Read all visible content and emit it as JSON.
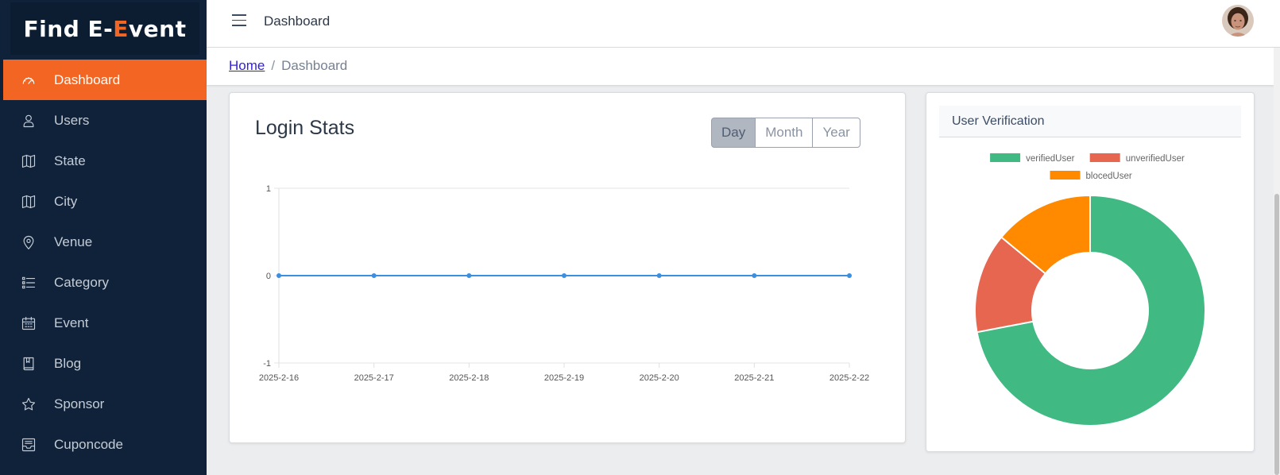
{
  "brand": {
    "part1": "Find E-",
    "accent": "E",
    "part2": "vent",
    "accent_color": "#f26522"
  },
  "sidebar": {
    "items": [
      {
        "label": "Dashboard",
        "icon": "speedometer-icon",
        "active": true
      },
      {
        "label": "Users",
        "icon": "user-icon"
      },
      {
        "label": "State",
        "icon": "map-icon"
      },
      {
        "label": "City",
        "icon": "map-icon"
      },
      {
        "label": "Venue",
        "icon": "location-pin-icon"
      },
      {
        "label": "Category",
        "icon": "list-icon"
      },
      {
        "label": "Event",
        "icon": "calendar-icon"
      },
      {
        "label": "Blog",
        "icon": "book-icon"
      },
      {
        "label": "Sponsor",
        "icon": "star-icon"
      },
      {
        "label": "Cuponcode",
        "icon": "inbox-icon"
      }
    ]
  },
  "header": {
    "title": "Dashboard"
  },
  "breadcrumb": {
    "home": "Home",
    "separator": "/",
    "current": "Dashboard"
  },
  "login_card": {
    "title": "Login Stats",
    "buttons": [
      {
        "label": "Day",
        "active": true
      },
      {
        "label": "Month"
      },
      {
        "label": "Year"
      }
    ]
  },
  "verify_card": {
    "title": "User Verification"
  },
  "chart_data": [
    {
      "type": "line",
      "x": [
        "2025-2-16",
        "2025-2-17",
        "2025-2-18",
        "2025-2-19",
        "2025-2-20",
        "2025-2-21",
        "2025-2-22"
      ],
      "series": [
        {
          "values": [
            0,
            0,
            0,
            0,
            0,
            0,
            0
          ],
          "color": "#3a8fe0"
        }
      ],
      "yticks": [
        "1",
        "0",
        "-1"
      ],
      "ylim": [
        -1,
        1
      ],
      "grid": true
    },
    {
      "type": "pie",
      "labels": [
        "verifiedUser",
        "unverifiedUser",
        "blocedUser"
      ],
      "values": [
        72,
        14,
        14
      ],
      "colors": [
        "#40b983",
        "#e66650",
        "#ff8a00"
      ],
      "legend": "top",
      "donut": true
    }
  ]
}
